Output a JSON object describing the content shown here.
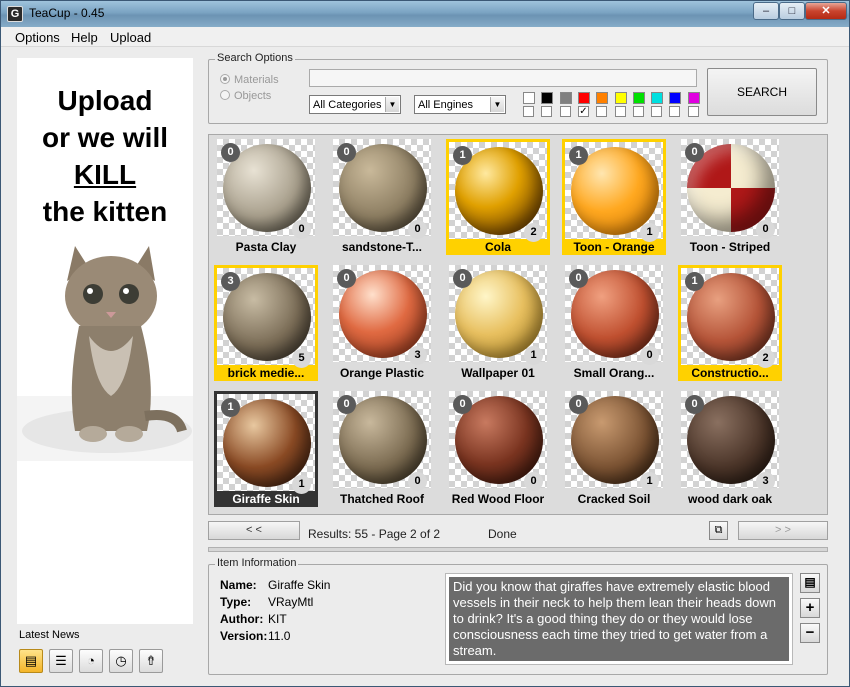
{
  "window": {
    "title": "TeaCup - 0.45",
    "app_icon": "G"
  },
  "menu": [
    "Options",
    "Help",
    "Upload"
  ],
  "ad": {
    "line1": "Upload",
    "line2": "or we will",
    "line3": "KILL",
    "line4": "the kitten"
  },
  "news": {
    "label": "Latest News",
    "icons": [
      "news-list-icon",
      "list-icon",
      "gauge-icon",
      "clock-icon",
      "upload-arrow-icon"
    ]
  },
  "search": {
    "group_label": "Search Options",
    "radio_materials": "Materials",
    "radio_objects": "Objects",
    "query": "",
    "category": "All Categories",
    "engine": "All Engines",
    "button": "SEARCH",
    "color_filters": [
      "#ffffff",
      "#000000",
      "#808080",
      "#ff0000",
      "#ff8000",
      "#ffff00",
      "#00e000",
      "#00e0e0",
      "#0000ff",
      "#e000e0"
    ],
    "color_checked": [
      false,
      false,
      false,
      true,
      false,
      false,
      false,
      false,
      false,
      false
    ]
  },
  "materials": [
    {
      "name": "Pasta Clay",
      "tl": "0",
      "br": "0",
      "sel": ""
    },
    {
      "name": "sandstone-T...",
      "tl": "0",
      "br": "0",
      "sel": ""
    },
    {
      "name": "Cola",
      "tl": "1",
      "br": "2",
      "sel": "gold"
    },
    {
      "name": "Toon - Orange",
      "tl": "1",
      "br": "1",
      "sel": "gold"
    },
    {
      "name": "Toon - Striped",
      "tl": "0",
      "br": "0",
      "sel": ""
    },
    {
      "name": "brick medie...",
      "tl": "3",
      "br": "5",
      "sel": "gold"
    },
    {
      "name": "Orange Plastic",
      "tl": "0",
      "br": "3",
      "sel": ""
    },
    {
      "name": "Wallpaper 01",
      "tl": "0",
      "br": "1",
      "sel": ""
    },
    {
      "name": "Small Orang...",
      "tl": "0",
      "br": "0",
      "sel": ""
    },
    {
      "name": "Constructio...",
      "tl": "1",
      "br": "2",
      "sel": "gold"
    },
    {
      "name": "Giraffe Skin",
      "tl": "1",
      "br": "1",
      "sel": "dark"
    },
    {
      "name": "Thatched Roof",
      "tl": "0",
      "br": "0",
      "sel": ""
    },
    {
      "name": "Red Wood Floor",
      "tl": "0",
      "br": "0",
      "sel": ""
    },
    {
      "name": "Cracked Soil",
      "tl": "0",
      "br": "1",
      "sel": ""
    },
    {
      "name": "wood dark oak",
      "tl": "0",
      "br": "3",
      "sel": ""
    }
  ],
  "pager": {
    "prev": "< <",
    "next": "> >",
    "results": "Results: 55 - Page 2 of 2",
    "status": "Done"
  },
  "item_info": {
    "group_label": "Item Information",
    "name_label": "Name:",
    "name": "Giraffe Skin",
    "type_label": "Type:",
    "type": "VRayMtl",
    "author_label": "Author:",
    "author": "KIT",
    "version_label": "Version:",
    "version": "11.0",
    "fact": "Did you know that giraffes have extremely elastic blood vessels in their neck to help them lean their heads down to drink? It's a good thing they do or they would lose consciousness each time they tried to get water from a stream."
  },
  "side_buttons": {
    "add_item_icon": "add-document-icon",
    "plus": "+",
    "minus": "−"
  }
}
